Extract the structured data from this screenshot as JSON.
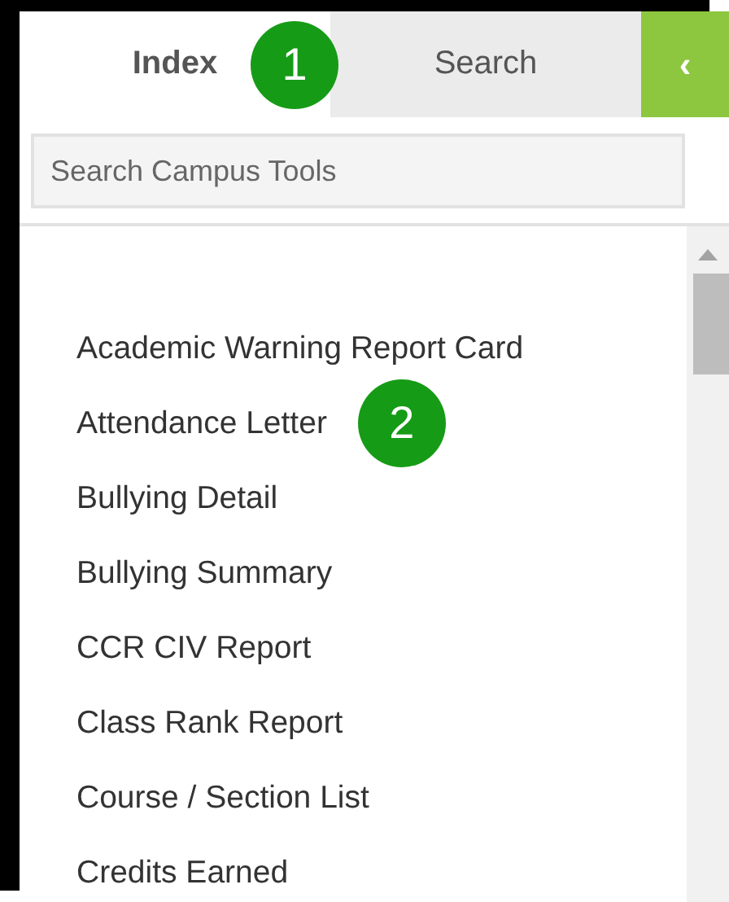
{
  "tabs": [
    {
      "label": "Index",
      "selected": true,
      "marker": "1"
    },
    {
      "label": "Search",
      "selected": false
    }
  ],
  "collapse_button": {
    "label": "‹"
  },
  "search": {
    "placeholder": "Search Campus Tools"
  },
  "tools": [
    {
      "label": "Academic Warning Report Card"
    },
    {
      "label": "Attendance Letter",
      "marker": "2"
    },
    {
      "label": "Bullying Detail"
    },
    {
      "label": "Bullying Summary"
    },
    {
      "label": "CCR CIV Report"
    },
    {
      "label": "Class Rank Report"
    },
    {
      "label": "Course / Section List"
    },
    {
      "label": "Credits Earned"
    }
  ]
}
